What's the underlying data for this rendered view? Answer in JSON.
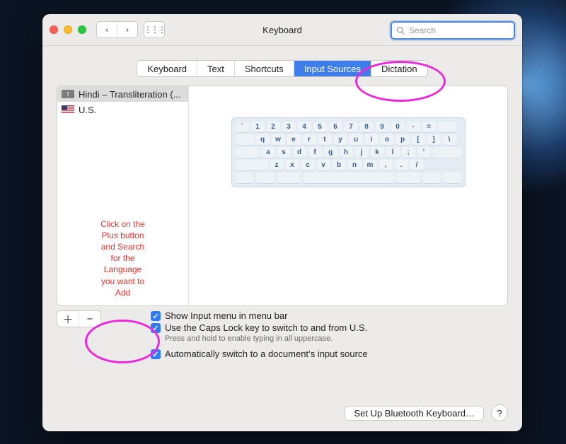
{
  "window": {
    "title": "Keyboard"
  },
  "search": {
    "placeholder": "Search"
  },
  "tabs": {
    "keyboard": "Keyboard",
    "text": "Text",
    "shortcuts": "Shortcuts",
    "input_sources": "Input Sources",
    "dictation": "Dictation"
  },
  "sources": [
    {
      "label": "Hindi – Transliteration (..."
    },
    {
      "label": "U.S."
    }
  ],
  "hint": "Click on the\nPlus button\nand Search\nfor the\nLanguage\nyou want to\nAdd",
  "keyboard_rows": [
    [
      "`",
      "1",
      "2",
      "3",
      "4",
      "5",
      "6",
      "7",
      "8",
      "9",
      "0",
      "-",
      "="
    ],
    [
      "q",
      "w",
      "e",
      "r",
      "t",
      "y",
      "u",
      "i",
      "o",
      "p",
      "[",
      "]",
      "\\"
    ],
    [
      "a",
      "s",
      "d",
      "f",
      "g",
      "h",
      "j",
      "k",
      "l",
      ";",
      "'"
    ],
    [
      "z",
      "x",
      "c",
      "v",
      "b",
      "n",
      "m",
      ",",
      ".",
      "/"
    ]
  ],
  "options": {
    "show_input_menu": "Show Input menu in menu bar",
    "caps_lock": "Use the Caps Lock key to switch to and from U.S.",
    "caps_lock_sub": "Press and hold to enable typing in all uppercase.",
    "auto_switch": "Automatically switch to a document’s input source"
  },
  "footer": {
    "bluetooth": "Set Up Bluetooth Keyboard…",
    "help": "?"
  },
  "icons": {
    "back": "‹",
    "forward": "›",
    "grid": "⋮⋮⋮",
    "add": "＋",
    "remove": "−",
    "check": "✓",
    "hi_glyph": "f̥"
  }
}
